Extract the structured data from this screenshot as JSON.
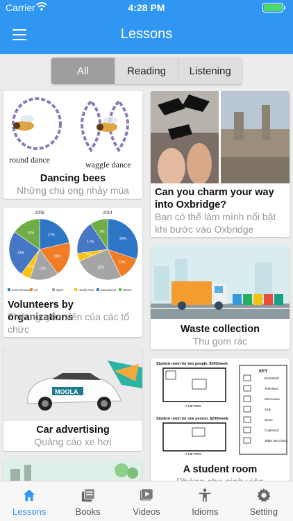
{
  "status": {
    "carrier": "Carrier",
    "time": "4:28 PM"
  },
  "header": {
    "title": "Lessons"
  },
  "filter": {
    "options": [
      "All",
      "Reading",
      "Listening"
    ],
    "selected": "All"
  },
  "lessons": [
    {
      "title": "Dancing bees",
      "subtitle": "Những chú ong nhảy múa",
      "image_labels": [
        "round dance",
        "waggle dance"
      ]
    },
    {
      "title": "Can you charm your way into Oxbridge?",
      "subtitle": "Bạn có thể làm mình nổi bật khi bước vào Oxbridge"
    },
    {
      "title": "Volunteers by organizations",
      "subtitle": "Tình nguyện viên của các tổ chức",
      "chart": {
        "years": [
          "2008",
          "2014"
        ],
        "legend": [
          "Environmental",
          "Art",
          "Sport",
          "Health Care",
          "Educational",
          "Others"
        ],
        "pie_2008": [
          21,
          18,
          15,
          5,
          24,
          15
        ],
        "pie_2014": [
          29,
          12,
          25,
          4,
          17,
          9
        ]
      }
    },
    {
      "title": "Waste collection",
      "subtitle": "Thu gom rác"
    },
    {
      "title": "Car advertising",
      "subtitle": "Quảng cáo xe hơi",
      "car_text": "MOOLA"
    },
    {
      "title": "A student room",
      "subtitle": "Phòng cho sinh viên",
      "plan_labels": [
        "Student room for two people. $350/week",
        "Student room for one person. $200/week",
        "6 METRES",
        "6 METRES",
        "KEY",
        "Bookshelf",
        "Television",
        "Microwave",
        "Sink",
        "Stove",
        "Cupboard",
        "Table and chairs"
      ]
    }
  ],
  "colors": {
    "primary": "#2f97f2"
  },
  "tabs": [
    {
      "label": "Lessons",
      "icon": "home-icon",
      "active": true
    },
    {
      "label": "Books",
      "icon": "books-icon"
    },
    {
      "label": "Videos",
      "icon": "video-icon"
    },
    {
      "label": "Idioms",
      "icon": "person-icon"
    },
    {
      "label": "Setting",
      "icon": "gear-icon"
    }
  ]
}
